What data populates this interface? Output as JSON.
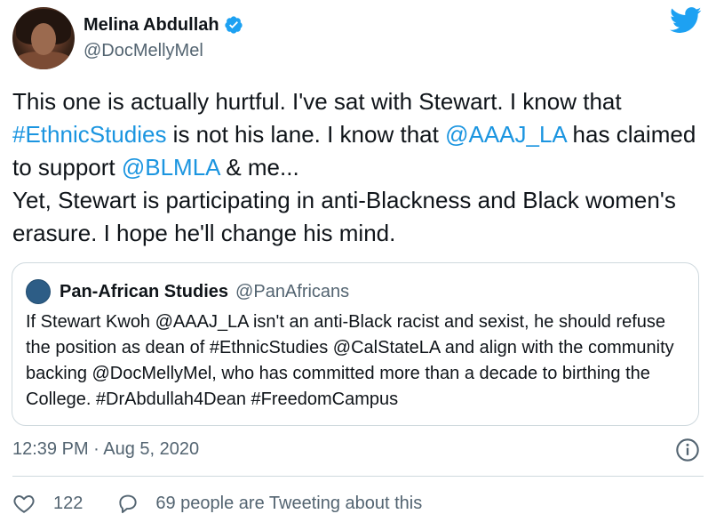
{
  "author": {
    "display_name": "Melina Abdullah",
    "handle": "@DocMellyMel",
    "verified": true
  },
  "tweet": {
    "segments": [
      {
        "text": "This one is actually hurtful. I've sat with Stewart. I know that ",
        "type": "text"
      },
      {
        "text": "#EthnicStudies",
        "type": "link"
      },
      {
        "text": " is not his lane. I know that ",
        "type": "text"
      },
      {
        "text": "@AAAJ_LA",
        "type": "link"
      },
      {
        "text": " has claimed to support ",
        "type": "text"
      },
      {
        "text": "@BLMLA",
        "type": "link"
      },
      {
        "text": " & me...",
        "type": "text"
      },
      {
        "text": "Yet, Stewart is participating in anti-Blackness and Black women's erasure. I hope he'll change his mind.",
        "type": "text"
      }
    ]
  },
  "quoted_tweet": {
    "display_name": "Pan-African Studies",
    "handle": "@PanAfricans",
    "text": "If Stewart Kwoh @AAAJ_LA isn't an anti-Black racist and sexist, he should refuse the position as dean of #EthnicStudies @CalStateLA and align with the community backing @DocMellyMel, who has committed more than a decade to birthing the College. #DrAbdullah4Dean #FreedomCampus"
  },
  "meta": {
    "timestamp": "12:39 PM · Aug 5, 2020"
  },
  "actions": {
    "like_count": "122",
    "reply_text": "69 people are Tweeting about this"
  },
  "icons": {
    "brand": "twitter-bird-icon",
    "verified": "verified-badge-icon",
    "info": "info-icon",
    "like": "heart-icon",
    "reply": "comment-bubble-icon"
  },
  "colors": {
    "link": "#1b95e0",
    "brand": "#1da1f2",
    "secondary_text": "#536471",
    "border": "#cfd9de"
  }
}
